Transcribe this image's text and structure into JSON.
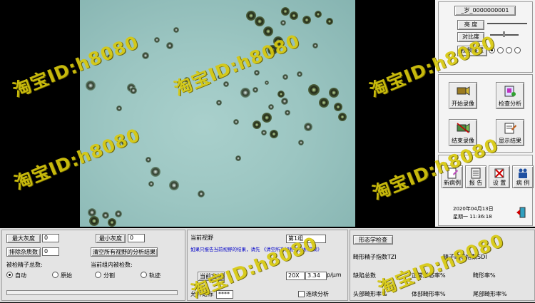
{
  "right_panel": {
    "patient_id": "_岁_0000000001",
    "brightness": "亮 度",
    "contrast": "对比度",
    "video_settings": "视频设置",
    "start_record": "开始录像",
    "check_analysis": "检查分析",
    "stop_record": "结束录像",
    "show_result": "显示结果",
    "new_case": "新病例",
    "report": "报 告",
    "settings": "设 置",
    "cases": "病 例",
    "date": "2020年04月13日",
    "time": "星期一  11:36:18"
  },
  "bottom": {
    "max_gray_label": "最大灰度",
    "max_gray_value": "0",
    "min_gray_label": "最小灰度",
    "min_gray_value": "0",
    "exclude_noise_label": "排除杂质数",
    "exclude_noise_value": "0",
    "clear_all_btn": "清空所有视野的分析结果",
    "total_sperm_label": "被检精子总数:",
    "group_sperm_label": "当前组内被检数:",
    "radio_auto": "自动",
    "radio_original": "原始",
    "radio_segment": "分割",
    "radio_track": "轨迹",
    "current_field_label": "当前视野",
    "group_select": "第1组",
    "info_text": "如果只报告当前视野的结果，请先 《清空所有视野的分析结果》",
    "current_calib_btn": "当前定标",
    "zoom_select": "20X",
    "scale_value": "3.34",
    "unit": "p/μm",
    "allow_calib_label": "允许定标",
    "allow_calib_value": "****",
    "continuous_label": "连续分析",
    "morph_check_btn": "形态学检查",
    "tzi_label": "畸形精子指数TZI",
    "sdi_label": "精子畸形指数SDI",
    "defect_total": "缺陷总数",
    "normal_rate": "正常形态率%",
    "abnormal_rate": "畸形率%",
    "head_abnormal": "头部畸形率%",
    "mid_abnormal": "体部畸形率%",
    "tail_abnormal": "尾部畸形率%"
  },
  "watermark": "淘宝ID:h8080",
  "colors": {
    "watermark": "#d8c90e",
    "link": "#0000c8"
  }
}
